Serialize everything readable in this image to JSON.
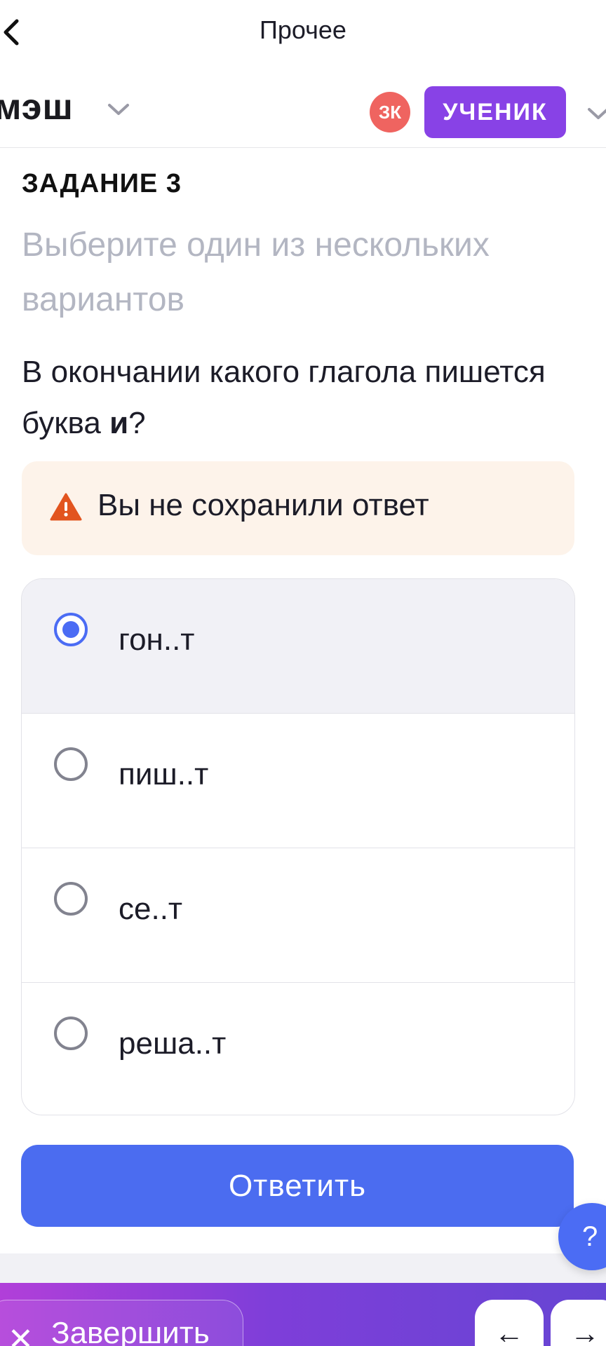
{
  "nav": {
    "title": "Прочее",
    "back_icon": "chevron-left-icon"
  },
  "header": {
    "logo": "мэш",
    "avatar_initials": "ЗК",
    "role": "УЧЕНИК"
  },
  "task": {
    "title": "ЗАДАНИЕ 3",
    "hint": "Выберите один из нескольких вариантов",
    "question_prefix": "В окончании какого глагола пишется буква ",
    "question_letter": "и",
    "question_suffix": "?"
  },
  "warning": {
    "text": "Вы не сохранили ответ",
    "icon": "warning-icon"
  },
  "options": [
    {
      "label": "гон..т",
      "selected": true
    },
    {
      "label": "пиш..т",
      "selected": false
    },
    {
      "label": "се..т",
      "selected": false
    },
    {
      "label": "реша..т",
      "selected": false
    }
  ],
  "answer_button": "Ответить",
  "help_button": "?",
  "bottom_bar": {
    "finish_label": "Завершить",
    "prev_icon": "←",
    "next_icon": "→"
  },
  "colors": {
    "accent": "#4b6cf0",
    "role_badge": "#8842e6",
    "avatar": "#ef6460",
    "warning_bg": "#fdf3ea",
    "warning_icon": "#e2541f"
  }
}
